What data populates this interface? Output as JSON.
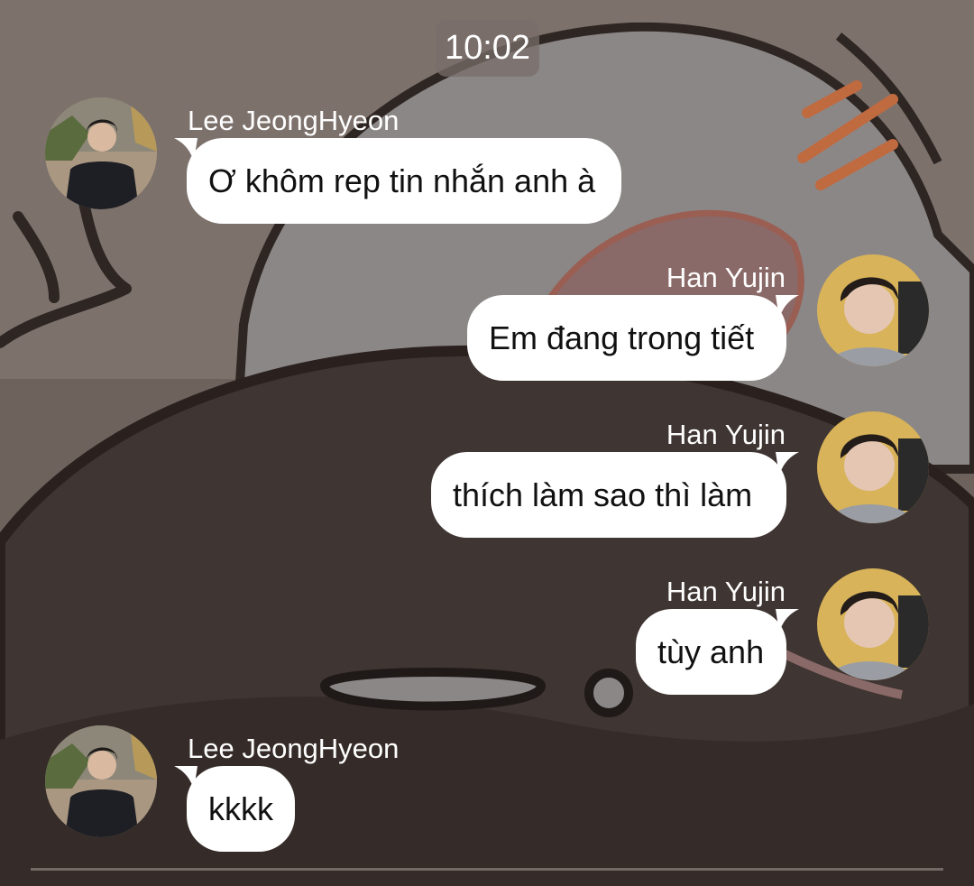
{
  "timestamp": "10:02",
  "messages": [
    {
      "sender": "Lee JeongHyeon",
      "text": "Ơ khôm rep tin nhắn anh à",
      "side": "left"
    },
    {
      "sender": "Han Yujin",
      "text": "Em đang trong tiết",
      "side": "right"
    },
    {
      "sender": "Han Yujin",
      "text": "thích làm sao thì làm",
      "side": "right"
    },
    {
      "sender": "Han Yujin",
      "text": "tùy anh",
      "side": "right"
    },
    {
      "sender": "Lee JeongHyeon",
      "text": "kkkk",
      "side": "left"
    }
  ],
  "colors": {
    "bubble": "#ffffff",
    "text": "#111111",
    "name_text": "#ffffff",
    "background": "#4a403c"
  }
}
